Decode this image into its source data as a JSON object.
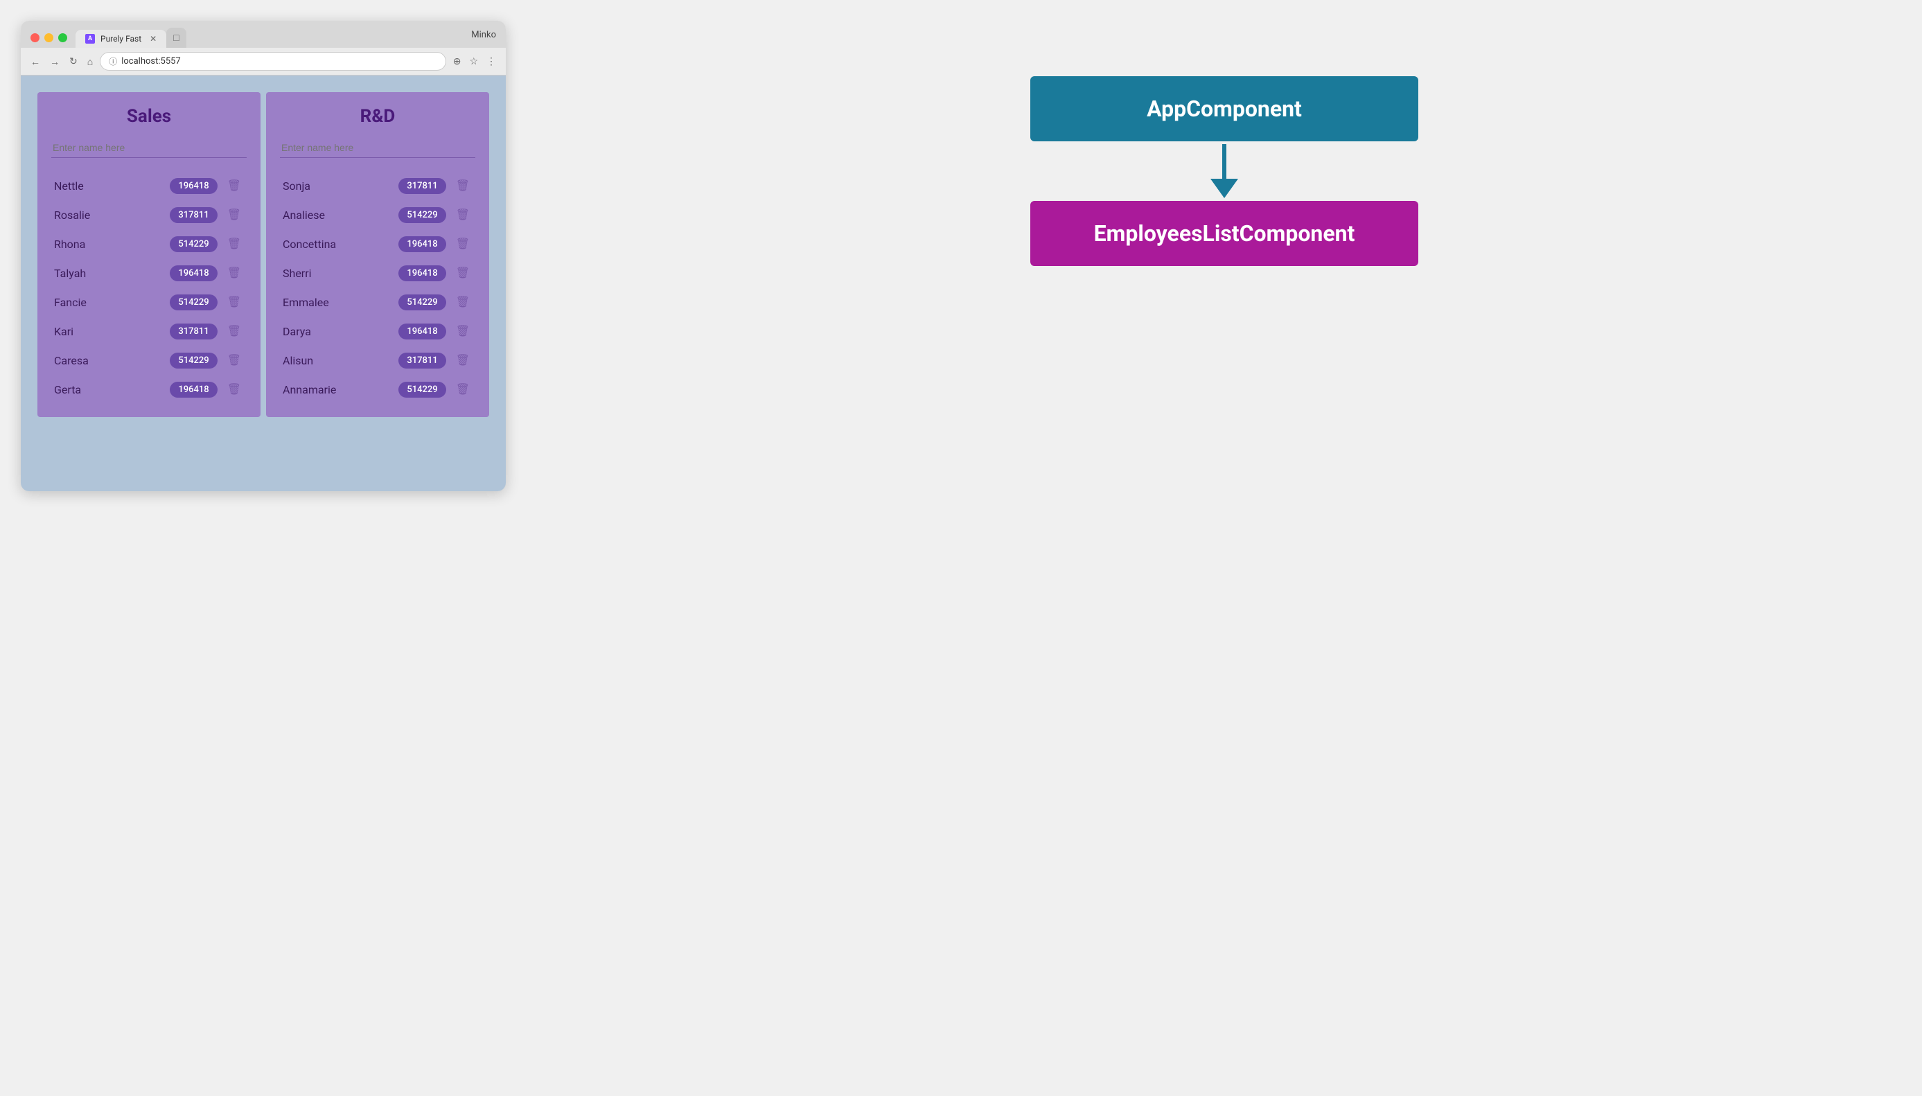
{
  "browser": {
    "tab_title": "Purely Fast",
    "tab_favicon": "A",
    "new_tab_symbol": "□",
    "address": "localhost:5557",
    "user": "Minko",
    "nav": {
      "back": "←",
      "forward": "→",
      "refresh": "↻",
      "home": "⌂"
    },
    "toolbar": {
      "cast": "⊕",
      "star": "☆",
      "menu": "⋮"
    }
  },
  "app": {
    "departments": [
      {
        "name": "Sales",
        "input_placeholder": "Enter name here",
        "employees": [
          {
            "name": "Nettle",
            "badge": "196418"
          },
          {
            "name": "Rosalie",
            "badge": "317811"
          },
          {
            "name": "Rhona",
            "badge": "514229"
          },
          {
            "name": "Talyah",
            "badge": "196418"
          },
          {
            "name": "Fancie",
            "badge": "514229"
          },
          {
            "name": "Kari",
            "badge": "317811"
          },
          {
            "name": "Caresa",
            "badge": "514229"
          },
          {
            "name": "Gerta",
            "badge": "196418"
          }
        ]
      },
      {
        "name": "R&D",
        "input_placeholder": "Enter name here",
        "employees": [
          {
            "name": "Sonja",
            "badge": "317811"
          },
          {
            "name": "Analiese",
            "badge": "514229"
          },
          {
            "name": "Concettina",
            "badge": "196418"
          },
          {
            "name": "Sherri",
            "badge": "196418"
          },
          {
            "name": "Emmalee",
            "badge": "514229"
          },
          {
            "name": "Darya",
            "badge": "196418"
          },
          {
            "name": "Alisun",
            "badge": "317811"
          },
          {
            "name": "Annamarie",
            "badge": "514229"
          }
        ]
      }
    ]
  },
  "diagram": {
    "app_component_label": "AppComponent",
    "employees_component_label": "EmployeesListComponent",
    "arrow_color": "#1a7a9a"
  }
}
